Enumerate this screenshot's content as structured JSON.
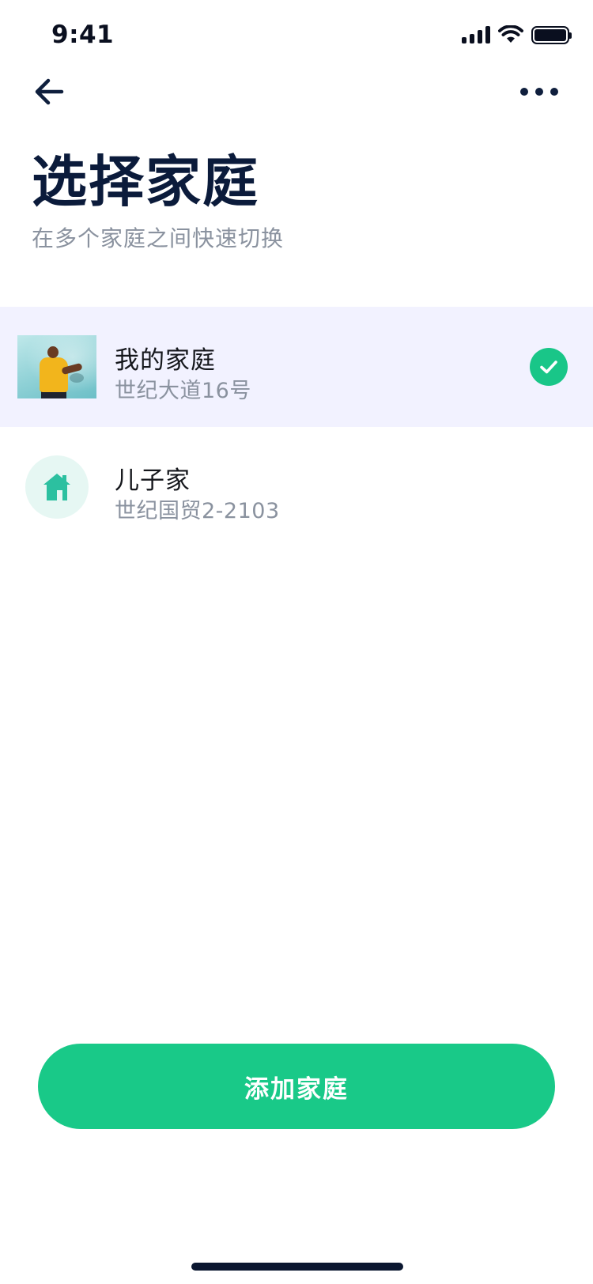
{
  "status_bar": {
    "time": "9:41",
    "icons": [
      "cellular-signal-icon",
      "wifi-icon",
      "battery-icon"
    ],
    "battery_level": 1.0
  },
  "nav": {
    "back_icon": "arrow-left-icon",
    "more_icon": "more-horizontal-icon"
  },
  "header": {
    "title": "选择家庭",
    "subtitle": "在多个家庭之间快速切换"
  },
  "homes": [
    {
      "name": "我的家庭",
      "address": "世纪大道16号",
      "thumbnail": "photo",
      "selected": true
    },
    {
      "name": "儿子家",
      "address": "世纪国贸2-2103",
      "thumbnail": "house-icon",
      "selected": false
    }
  ],
  "actions": {
    "add_home_label": "添加家庭"
  },
  "colors": {
    "accent_green": "#19c988",
    "title_navy": "#0b1b3b",
    "secondary_text": "#8a929f",
    "selected_row_bg": "#f2f2ff",
    "house_icon": "#2cc0a0"
  }
}
